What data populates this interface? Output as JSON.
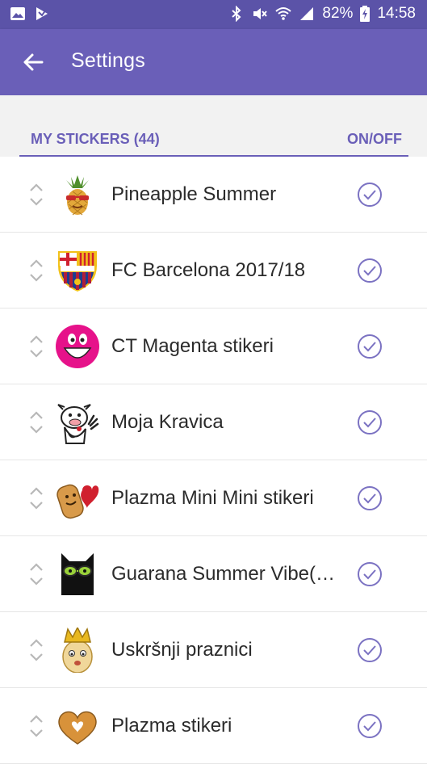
{
  "status_bar": {
    "battery": "82%",
    "time": "14:58",
    "icons": [
      "image-icon",
      "download-icon",
      "bluetooth-icon",
      "mute-icon",
      "wifi-icon",
      "signal-icon",
      "battery-charging-icon"
    ]
  },
  "app_bar": {
    "title": "Settings",
    "back_icon": "arrow-back-icon"
  },
  "section": {
    "title": "MY STICKERS (44)",
    "toggle_header": "ON/OFF"
  },
  "stickers": [
    {
      "name": "Pineapple Summer",
      "icon": "pineapple-sticker",
      "enabled": true
    },
    {
      "name": "FC Barcelona 2017/18",
      "icon": "fc-barcelona-crest",
      "enabled": true
    },
    {
      "name": "CT Magenta stikeri",
      "icon": "magenta-smiley-sticker",
      "enabled": true
    },
    {
      "name": "Moja Kravica",
      "icon": "cow-sticker",
      "enabled": true
    },
    {
      "name": "Plazma Mini Mini stikeri",
      "icon": "plazma-biscuit-sticker",
      "enabled": true
    },
    {
      "name": "Guarana Summer Vibe(…",
      "icon": "black-cat-sunglasses-sticker",
      "enabled": true
    },
    {
      "name": "Uskršnji praznici",
      "icon": "egg-crown-sticker",
      "enabled": true
    },
    {
      "name": "Plazma stikeri",
      "icon": "biscuit-heart-sticker",
      "enabled": true
    }
  ],
  "colors": {
    "primary": "#6a5fb8",
    "status_bar": "#5b53a8",
    "check": "#7b72c2"
  }
}
